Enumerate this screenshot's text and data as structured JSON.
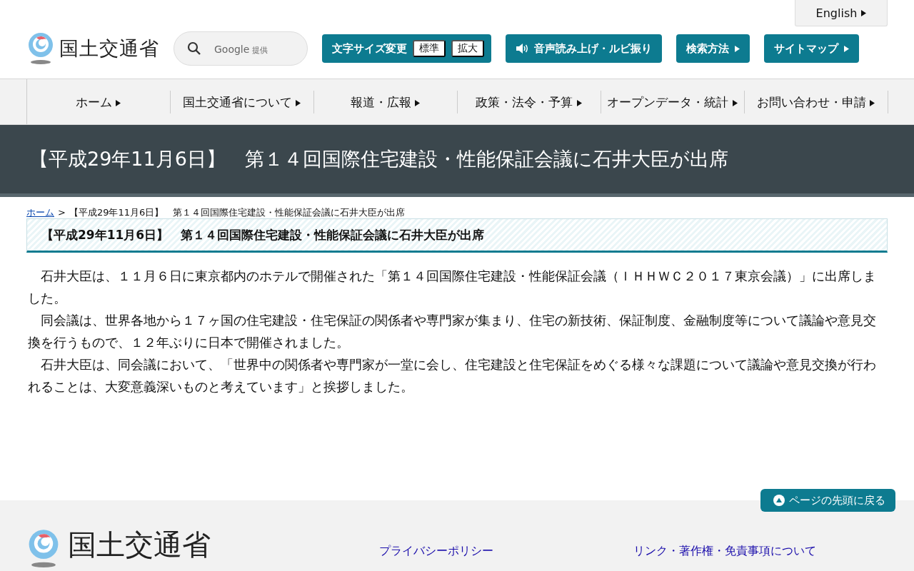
{
  "header": {
    "logo_text": "国土交通省",
    "search": {
      "brand": "Google",
      "note": "提供"
    },
    "english": "English",
    "font_size": {
      "label": "文字サイズ変更",
      "options": [
        "標準",
        "拡大"
      ]
    },
    "tools": [
      {
        "label": "音声読み上げ・ルビ振り",
        "kind": "speaker"
      },
      {
        "label": "検索方法",
        "kind": "arrow"
      },
      {
        "label": "サイトマップ",
        "kind": "arrow"
      }
    ]
  },
  "nav": [
    "ホーム",
    "国土交通省について",
    "報道・広報",
    "政策・法令・予算",
    "オープンデータ・統計",
    "お問い合わせ・申請"
  ],
  "page_title": "【平成29年11月6日】　第１４回国際住宅建設・性能保証会議に石井大臣が出席",
  "breadcrumb": {
    "home": "ホーム",
    "separator": ">",
    "current": "【平成29年11月6日】　第１４回国際住宅建設・性能保証会議に石井大臣が出席"
  },
  "heading": "【平成29年11月6日】　第１４回国際住宅建設・性能保証会議に石井大臣が出席",
  "paragraphs": [
    "石井大臣は、１１月６日に東京都内のホテルで開催された「第１４回国際住宅建設・性能保証会議（ＩＨＨＷＣ２０１７東京会議）」に出席しました。",
    "同会議は、世界各地から１７ヶ国の住宅建設・住宅保証の関係者や専門家が集まり、住宅の新技術、保証制度、金融制度等について議論や意見交換を行うもので、１２年ぶりに日本で開催されました。",
    "石井大臣は、同会議において、「世界中の関係者や専門家が一堂に会し、住宅建設と住宅保証をめぐる様々な課題について議論や意見交換が行われることは、大変意義深いものと考えています」と挨拶しました。"
  ],
  "back_to_top": "ページの先頭に戻る",
  "footer": {
    "logo_text": "国土交通省",
    "links": [
      "プライバシーポリシー",
      "リンク・著作権・免責事項について"
    ]
  }
}
